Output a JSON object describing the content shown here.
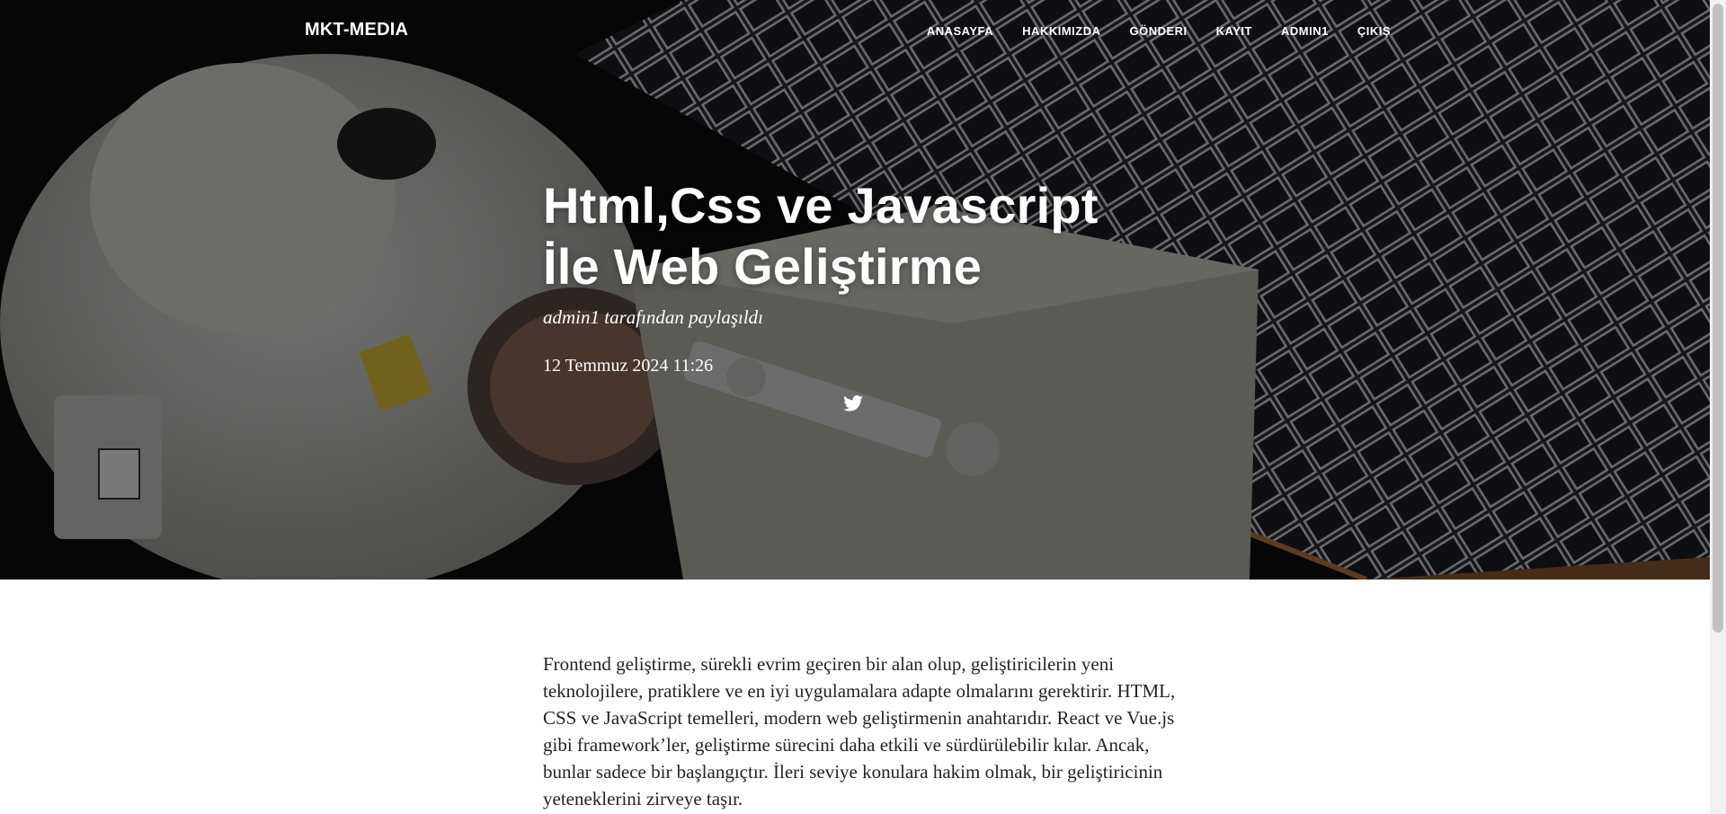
{
  "brand": "MKT-MEDIA",
  "nav": {
    "items": [
      "ANASAYFA",
      "HAKKIMIZDA",
      "GÖNDERI",
      "KAYIT",
      "ADMIN1",
      "ÇIKIŞ"
    ]
  },
  "hero": {
    "image": "astronaut-spacewalk-space-station",
    "title_line1": "Html,Css ve Javascript",
    "title_line2": "İle Web Geliştirme",
    "subtitle": "admin1 tarafından paylaşıldı",
    "date": "12 Temmuz 2024 11:26",
    "share_icon": "twitter-icon"
  },
  "content": {
    "paragraph": "Frontend geliştirme, sürekli evrim geçiren bir alan olup, geliştiricilerin yeni teknolojilere, pratiklere ve en iyi uygulamalara adapte olmalarını gerektirir. HTML, CSS ve JavaScript temelleri, modern web geliştirmenin anahtarıdır. React ve Vue.js gibi framework’ler, geliştirme sürecini daha etkili ve sürdürülebilir kılar. Ancak, bunlar sadece bir başlangıçtır. İleri seviye konulara hakim olmak, bir geliştiricinin yeteneklerini zirveye taşır."
  },
  "colors": {
    "hero_overlay": "#000000",
    "text": "#212529",
    "nav_text": "#ffffff"
  }
}
